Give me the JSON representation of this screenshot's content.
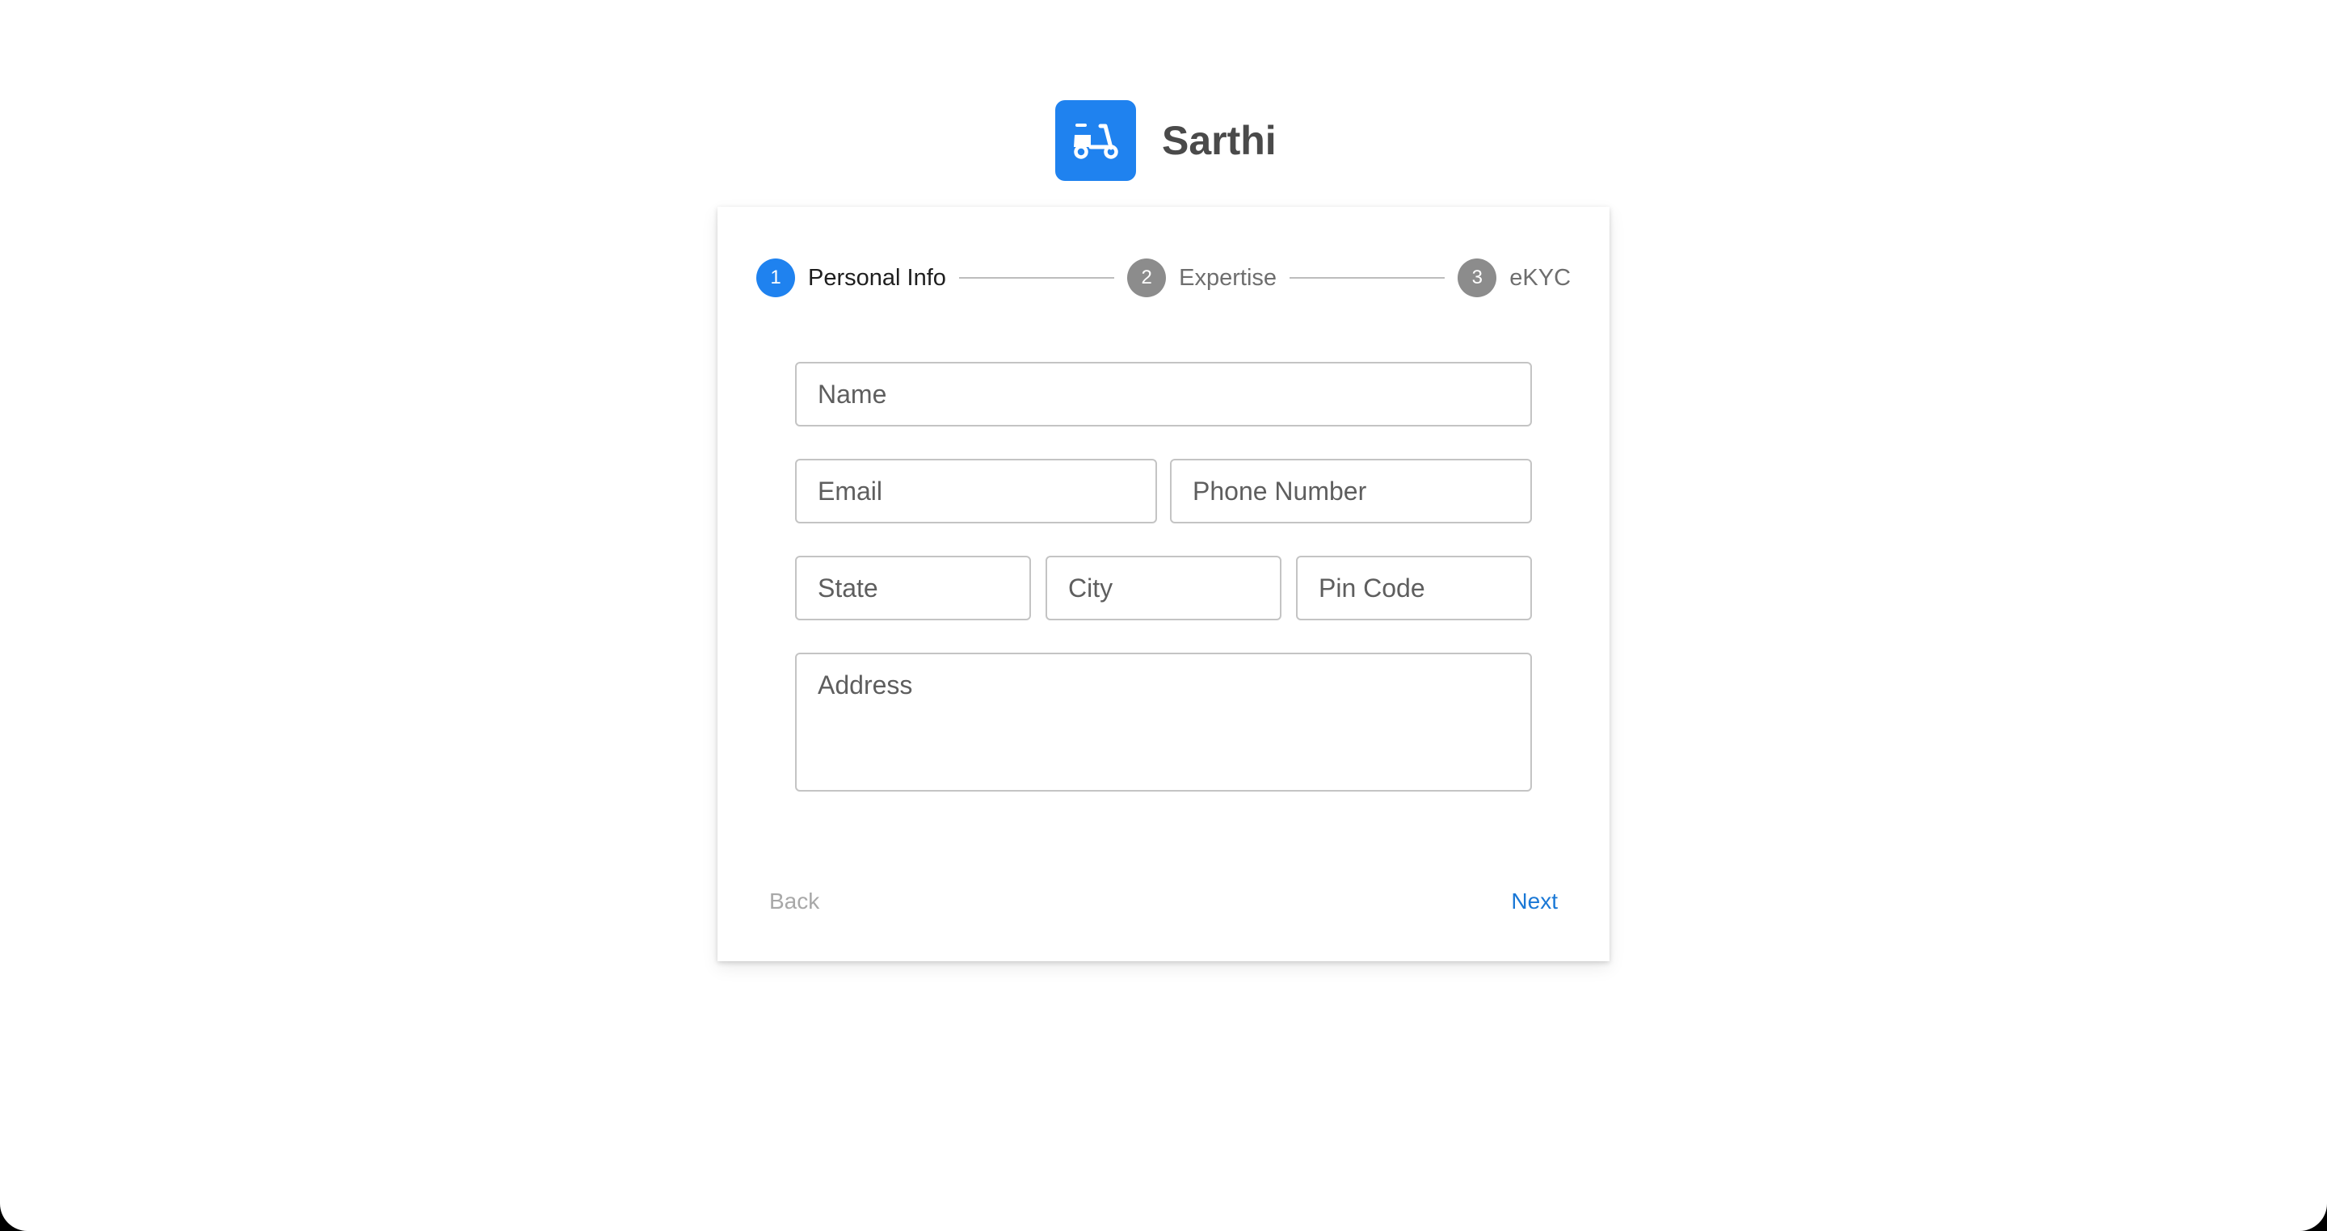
{
  "app": {
    "title": "Sarthi",
    "logo_icon": "scooter-icon",
    "brand_color": "#1f82ef"
  },
  "stepper": {
    "steps": [
      {
        "number": "1",
        "label": "Personal Info",
        "state": "active"
      },
      {
        "number": "2",
        "label": "Expertise",
        "state": "inactive"
      },
      {
        "number": "3",
        "label": "eKYC",
        "state": "inactive"
      }
    ]
  },
  "form": {
    "name": {
      "placeholder": "Name",
      "value": ""
    },
    "email": {
      "placeholder": "Email",
      "value": ""
    },
    "phone": {
      "placeholder": "Phone Number",
      "value": ""
    },
    "state": {
      "placeholder": "State",
      "value": ""
    },
    "city": {
      "placeholder": "City",
      "value": ""
    },
    "pin_code": {
      "placeholder": "Pin Code",
      "value": ""
    },
    "address": {
      "placeholder": "Address",
      "value": ""
    }
  },
  "actions": {
    "back_label": "Back",
    "next_label": "Next"
  }
}
